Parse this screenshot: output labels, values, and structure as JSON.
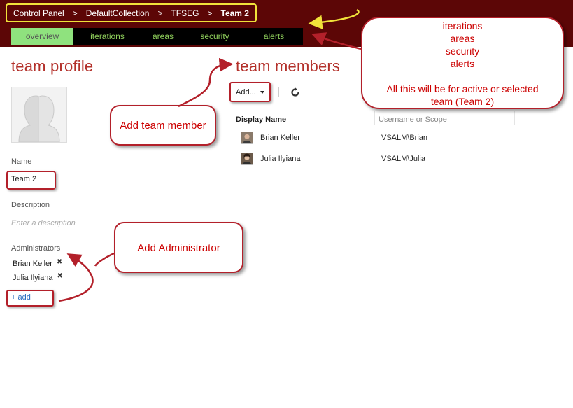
{
  "breadcrumb": {
    "items": [
      "Control Panel",
      "DefaultCollection",
      "TFSEG"
    ],
    "separator": ">",
    "current": "Team 2"
  },
  "tabs": [
    {
      "label": "overview",
      "active": true
    },
    {
      "label": "iterations",
      "active": false
    },
    {
      "label": "areas",
      "active": false
    },
    {
      "label": "security",
      "active": false
    },
    {
      "label": "alerts",
      "active": false
    }
  ],
  "profile": {
    "heading": "team profile",
    "name_label": "Name",
    "name_value": "Team 2",
    "description_label": "Description",
    "description_placeholder": "Enter a description",
    "administrators_label": "Administrators",
    "administrators": [
      "Brian Keller",
      "Julia Ilyiana"
    ],
    "add_link": "+ add"
  },
  "members": {
    "heading": "team members",
    "add_button": "Add...",
    "columns": {
      "display_name": "Display Name",
      "username": "Username or Scope"
    },
    "rows": [
      {
        "name": "Brian Keller",
        "username": "VSALM\\Brian"
      },
      {
        "name": "Julia Ilyiana",
        "username": "VSALM\\Julia"
      }
    ]
  },
  "callouts": {
    "tabs_note": [
      "iterations",
      "areas",
      "security",
      "alerts",
      "",
      "All this will be for active or selected team (Team 2)"
    ],
    "add_member": "Add team member",
    "add_admin": "Add Administrator"
  },
  "colors": {
    "header_bg": "#5c0606",
    "accent_red": "#b3302a",
    "tab_active_bg": "#8fe27e",
    "tab_text": "#8fcf5c",
    "highlight_yellow": "#f1e23a",
    "link_blue": "#2a6fc0"
  }
}
